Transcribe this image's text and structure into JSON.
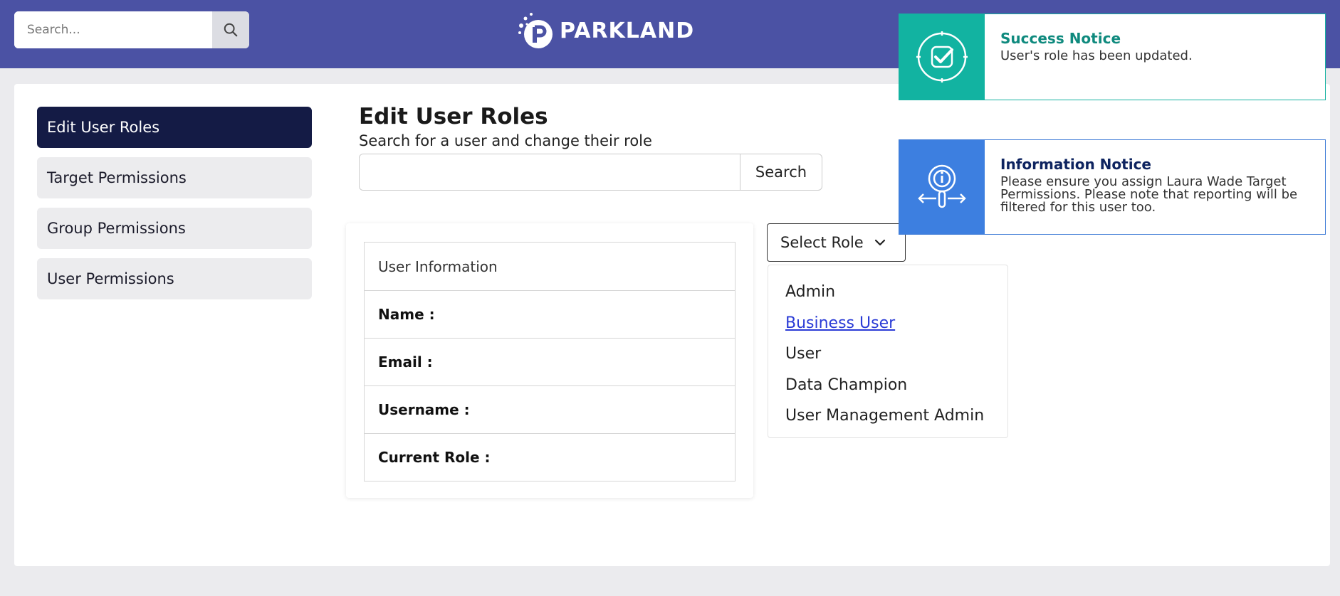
{
  "header": {
    "search_placeholder": "Search...",
    "logo_text": "PARKLAND"
  },
  "sidebar": {
    "items": [
      {
        "label": "Edit User Roles",
        "active": true
      },
      {
        "label": "Target Permissions",
        "active": false
      },
      {
        "label": "Group Permissions",
        "active": false
      },
      {
        "label": "User Permissions",
        "active": false
      }
    ]
  },
  "main": {
    "title": "Edit User Roles",
    "subtitle": "Search for a user and change their role",
    "search_value": "",
    "search_button": "Search"
  },
  "user_info": {
    "heading": "User Information",
    "fields": [
      "Name :",
      "Email :",
      "Username :",
      "Current Role :"
    ]
  },
  "role_select": {
    "label": "Select Role",
    "options": [
      "Admin",
      "Business User",
      "User",
      "Data Champion",
      "User Management Admin"
    ],
    "hovered": "Business User"
  },
  "toasts": {
    "success": {
      "title": "Success Notice",
      "text": "User's role has been updated."
    },
    "info": {
      "title": "Information Notice",
      "text": "Please ensure you assign Laura Wade Target Permissions. Please note that reporting will be filtered for this user too."
    }
  },
  "colors": {
    "header_bg": "#4b52a4",
    "sidebar_active": "#141b45",
    "success": "#12b3a1",
    "info": "#3d7fe0"
  }
}
